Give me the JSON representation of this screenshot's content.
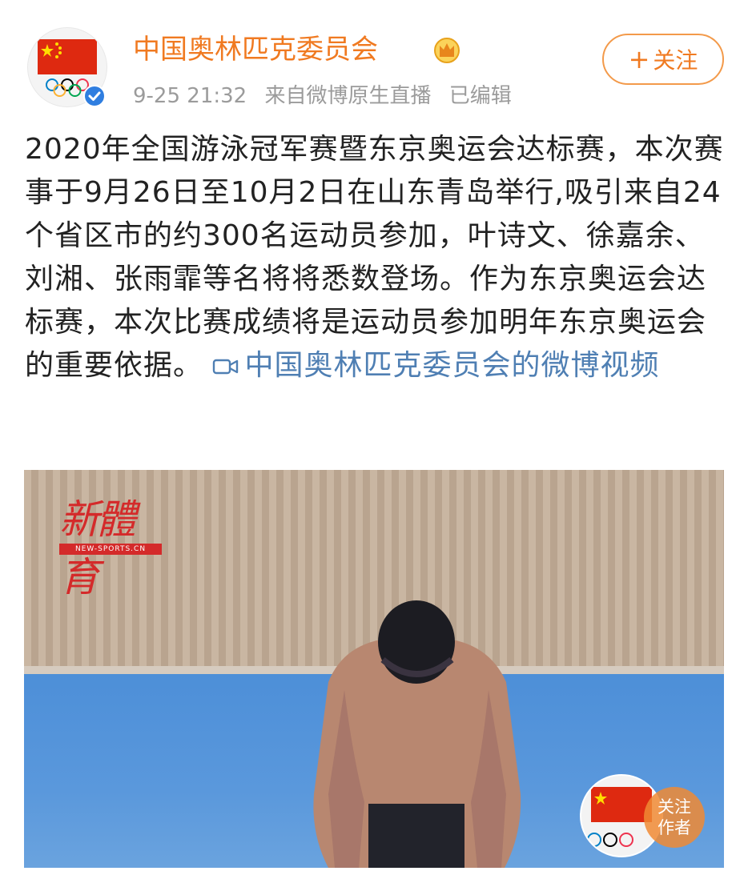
{
  "post": {
    "author_name": "中国奥林匹克委员会",
    "timestamp": "9-25 21:32",
    "source": "来自微博原生直播",
    "edited": "已编辑",
    "follow_label": "关注",
    "follow_plus": "+"
  },
  "content": {
    "text": "2020年全国游泳冠军赛暨东京奥运会达标赛，本次赛事于9月26日至10月2日在山东青岛举行,吸引来自24个省区市的约300名运动员参加，叶诗文、徐嘉余、刘湘、张雨霏等名将将悉数登场。作为东京奥运会达标赛，本次比赛成绩将是运动员参加明年东京奥运会的重要依据。",
    "video_link": "中国奥林匹克委员会的微博视频"
  },
  "video": {
    "watermark_text": "新體育",
    "watermark_sub": "NEW-SPORTS.CN",
    "follow_author_line1": "关注",
    "follow_author_line2": "作者"
  },
  "colors": {
    "accent": "#f07a21",
    "link": "#4f7fb3",
    "meta": "#9b9b9b",
    "verified": "#2f7ee0"
  },
  "icons": [
    "china-flag-icon",
    "olympic-rings-icon",
    "verified-icon",
    "crown-badge-icon",
    "video-camera-icon"
  ]
}
